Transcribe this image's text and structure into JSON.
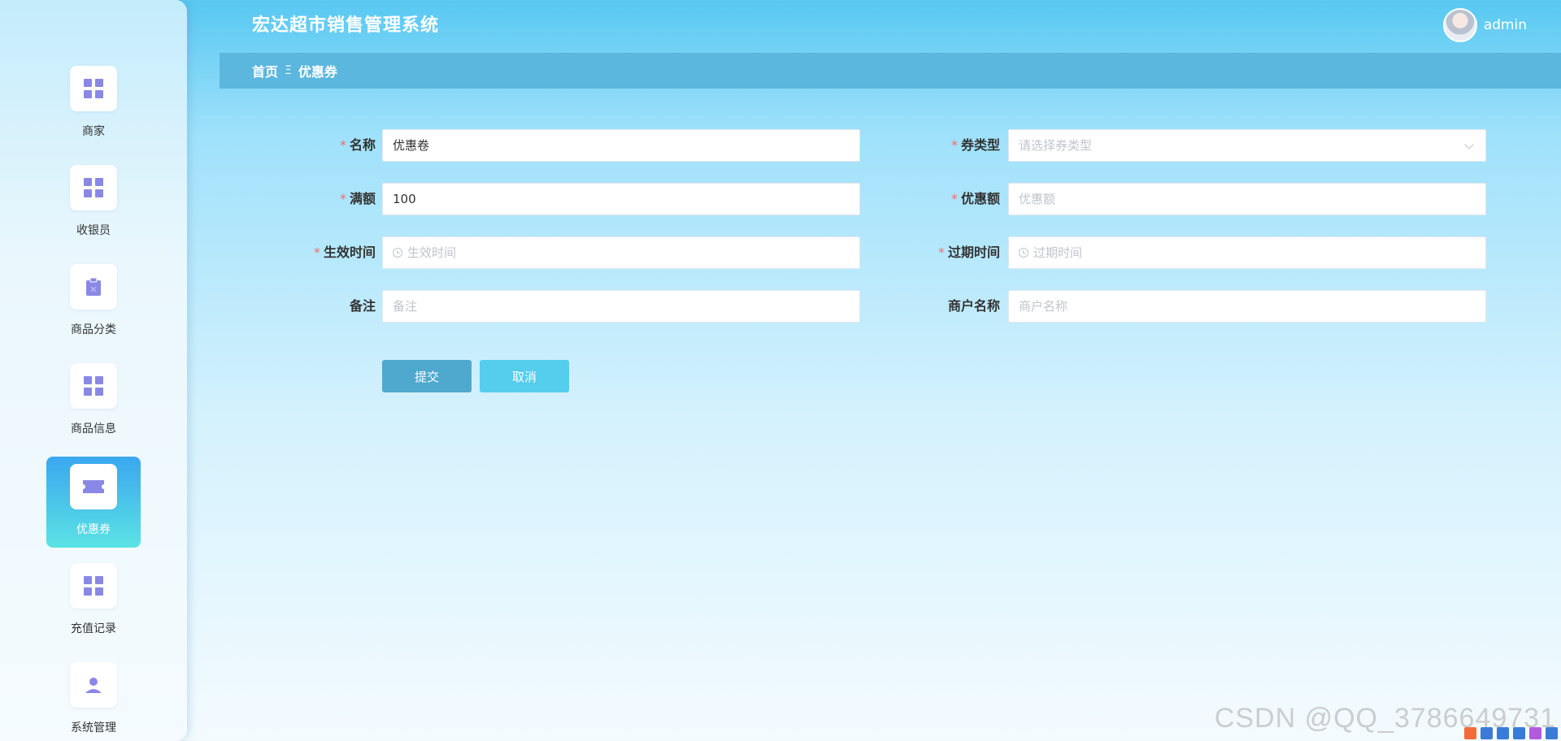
{
  "header": {
    "app_title": "宏达超市销售管理系统",
    "username": "admin"
  },
  "breadcrumb": {
    "home": "首页",
    "separator": "Ξ",
    "current": "优惠券"
  },
  "sidebar": {
    "items": [
      {
        "label": "商家",
        "icon": "grid-icon",
        "active": false
      },
      {
        "label": "收银员",
        "icon": "grid-icon",
        "active": false
      },
      {
        "label": "商品分类",
        "icon": "clipboard-icon",
        "active": false
      },
      {
        "label": "商品信息",
        "icon": "grid-icon",
        "active": false
      },
      {
        "label": "优惠券",
        "icon": "ticket-icon",
        "active": true
      },
      {
        "label": "充值记录",
        "icon": "grid-icon",
        "active": false
      },
      {
        "label": "系统管理",
        "icon": "user-icon",
        "active": false
      }
    ]
  },
  "form": {
    "name": {
      "label": "名称",
      "required": true,
      "value": "优惠卷"
    },
    "coupon_type": {
      "label": "券类型",
      "required": true,
      "placeholder": "请选择券类型"
    },
    "threshold": {
      "label": "满额",
      "required": true,
      "value": "100"
    },
    "discount": {
      "label": "优惠额",
      "required": true,
      "placeholder": "优惠额"
    },
    "start_time": {
      "label": "生效时间",
      "required": true,
      "placeholder": "生效时间"
    },
    "expire_time": {
      "label": "过期时间",
      "required": true,
      "placeholder": "过期时间"
    },
    "remark": {
      "label": "备注",
      "required": false,
      "placeholder": "备注"
    },
    "merchant_name": {
      "label": "商户名称",
      "required": false,
      "placeholder": "商户名称"
    }
  },
  "buttons": {
    "submit": "提交",
    "cancel": "取消"
  },
  "watermark": "CSDN @QQ_3786649731",
  "colors": {
    "accent": "#4fa9cf",
    "active_menu_top": "#3aa7f0",
    "active_menu_bottom": "#5be3e4",
    "required": "#f56c6c",
    "icon": "#8a88e6"
  }
}
